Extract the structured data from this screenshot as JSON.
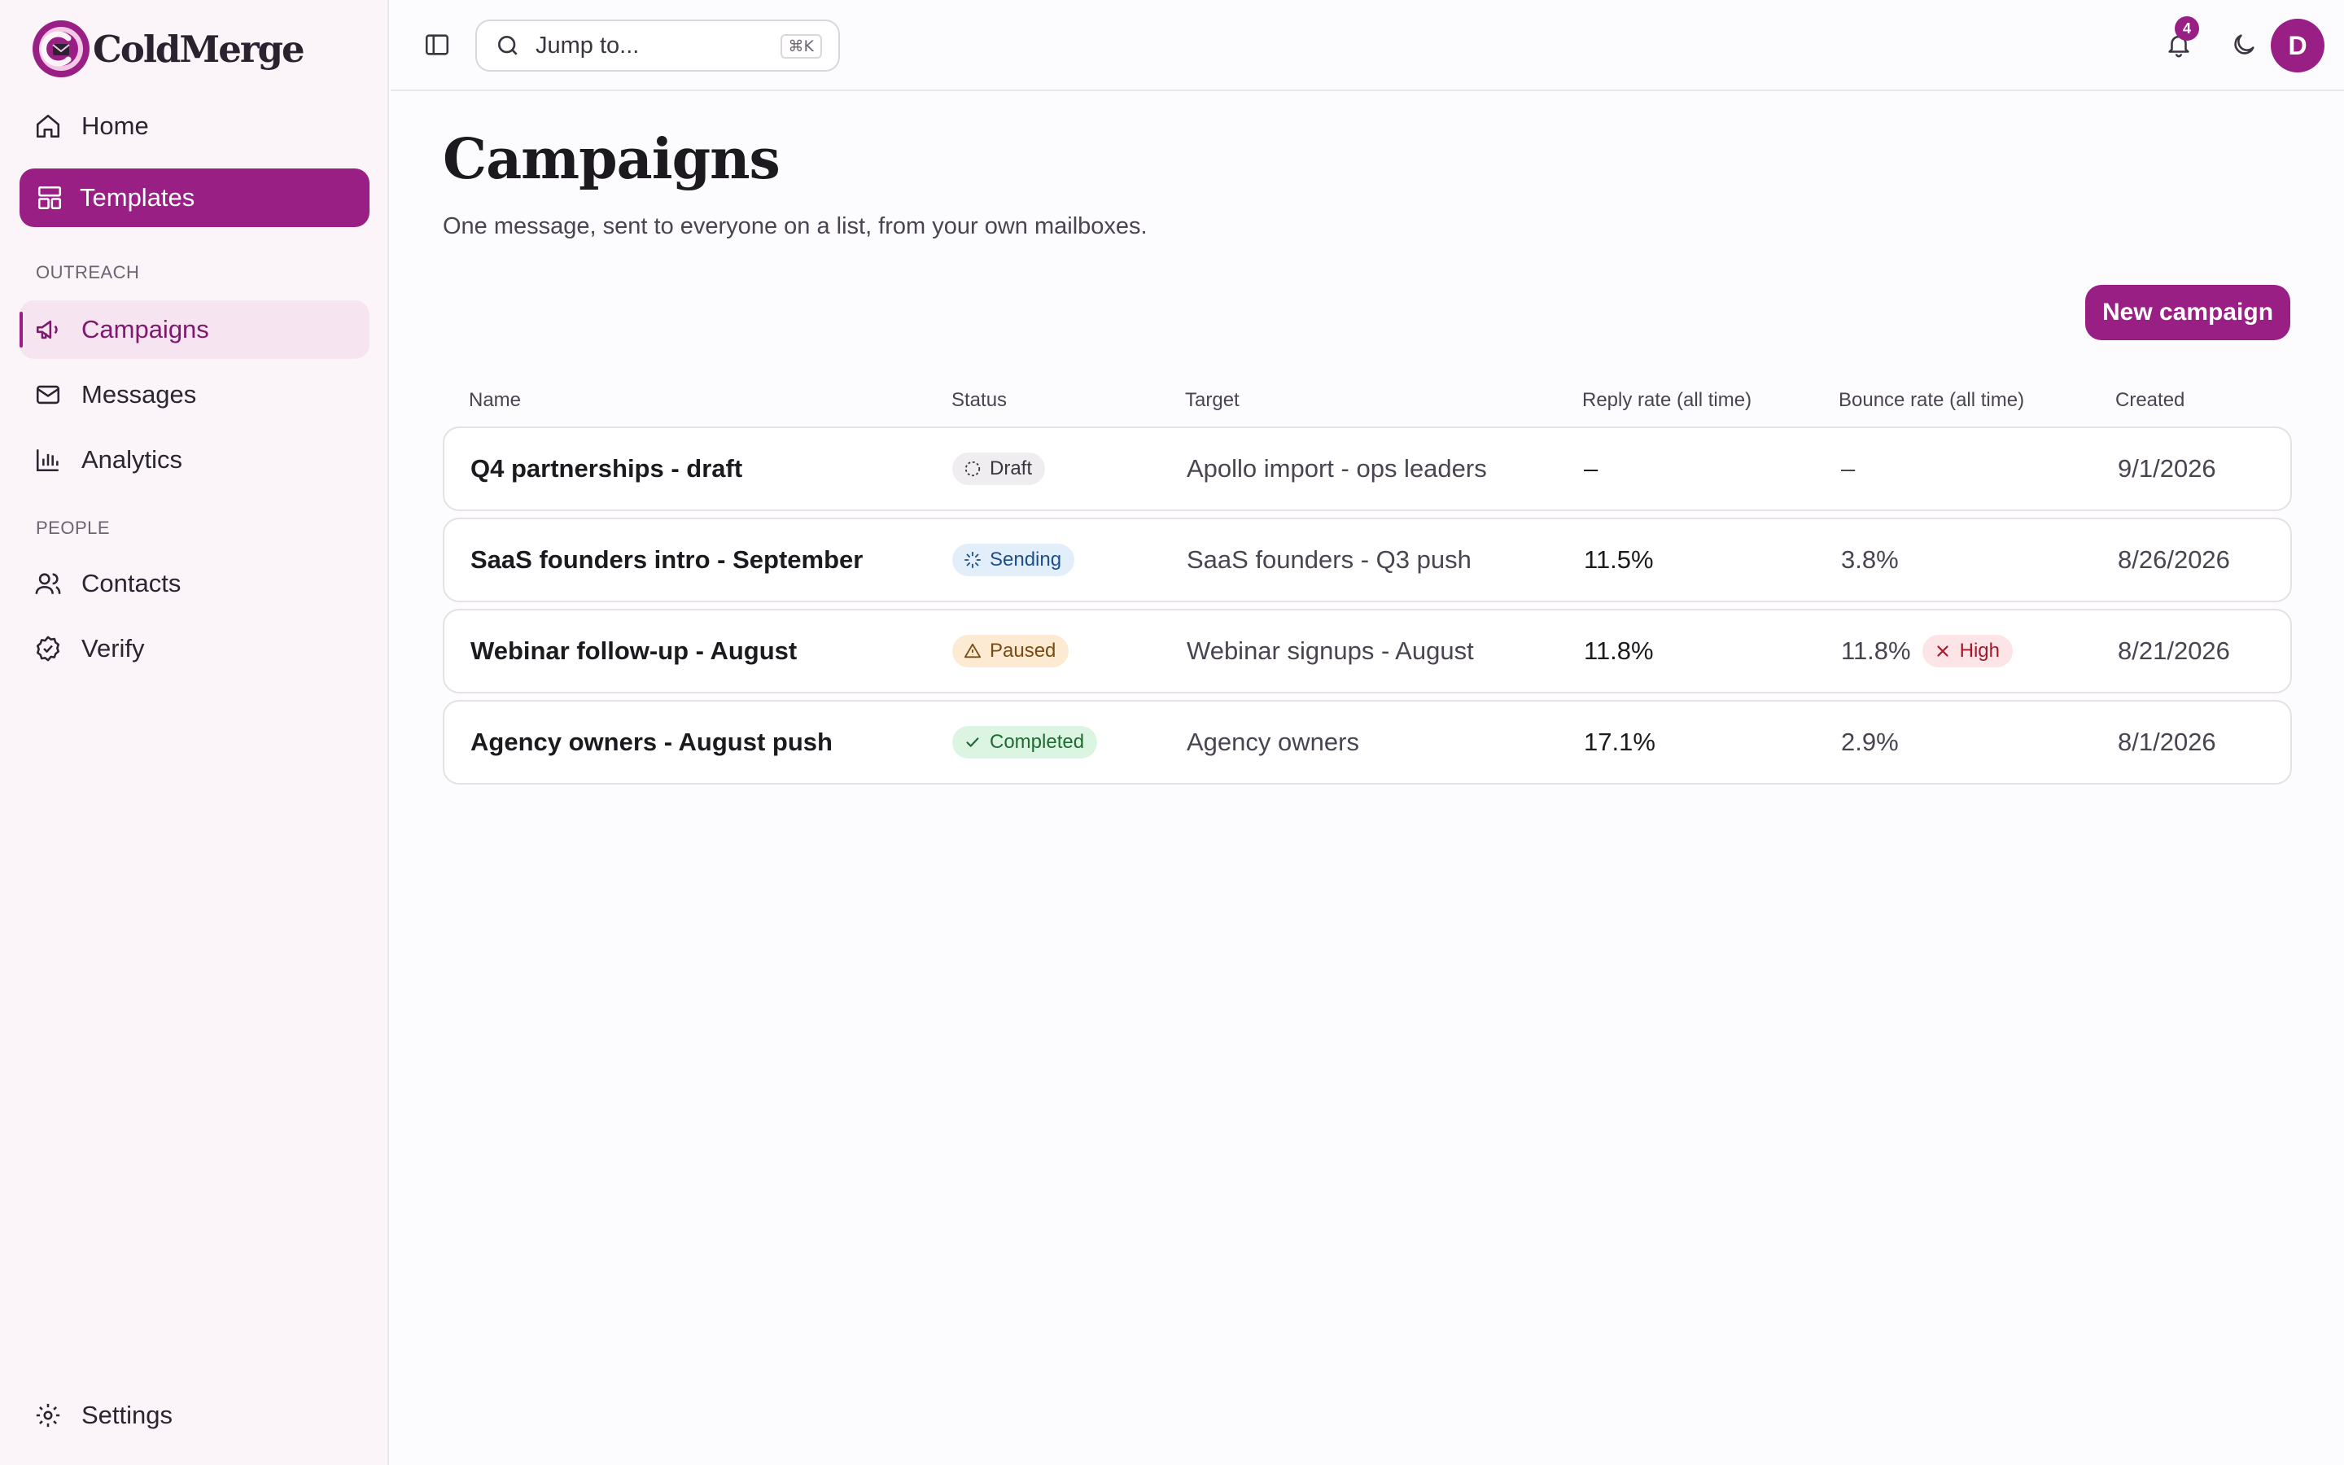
{
  "app": {
    "name": "ColdMerge"
  },
  "sidebar": {
    "items_top": [
      {
        "label": "Home",
        "icon": "home-icon"
      },
      {
        "label": "Templates",
        "icon": "layout-icon"
      }
    ],
    "sections": [
      {
        "label": "OUTREACH",
        "items": [
          {
            "label": "Campaigns",
            "icon": "megaphone-icon"
          },
          {
            "label": "Messages",
            "icon": "mail-icon"
          },
          {
            "label": "Analytics",
            "icon": "bar-chart-icon"
          }
        ]
      },
      {
        "label": "PEOPLE",
        "items": [
          {
            "label": "Contacts",
            "icon": "users-icon"
          },
          {
            "label": "Verify",
            "icon": "check-badge-icon"
          }
        ]
      }
    ],
    "settings_label": "Settings"
  },
  "topbar": {
    "search_placeholder": "Jump to...",
    "search_shortcut": "⌘K",
    "notification_count": "4",
    "avatar_initial": "D"
  },
  "page": {
    "title": "Campaigns",
    "subtitle": "One message, sent to everyone on a list, from your own mailboxes.",
    "new_button_label": "New campaign"
  },
  "table": {
    "columns": [
      "Name",
      "Status",
      "Target",
      "Reply rate (all time)",
      "Bounce rate (all time)",
      "Created"
    ],
    "rows": [
      {
        "name": "Q4 partnerships - draft",
        "status": "Draft",
        "target": "Apollo import - ops leaders",
        "reply_rate": "–",
        "bounce_rate": "–",
        "created": "9/1/2026"
      },
      {
        "name": "SaaS founders intro - September",
        "status": "Sending",
        "target": "SaaS founders - Q3 push",
        "reply_rate": "11.5%",
        "bounce_rate": "3.8%",
        "created": "8/26/2026"
      },
      {
        "name": "Webinar follow-up - August",
        "status": "Paused",
        "target": "Webinar signups - August",
        "reply_rate": "11.8%",
        "bounce_rate": "11.8%",
        "bounce_flag": "High",
        "created": "8/21/2026"
      },
      {
        "name": "Agency owners - August push",
        "status": "Completed",
        "target": "Agency owners",
        "reply_rate": "17.1%",
        "bounce_rate": "2.9%",
        "created": "8/1/2026"
      }
    ]
  },
  "colors": {
    "brand": "#9a1f85",
    "sidebar_bg": "#fbf5f9",
    "active_soft_bg": "#f6e4f1"
  }
}
